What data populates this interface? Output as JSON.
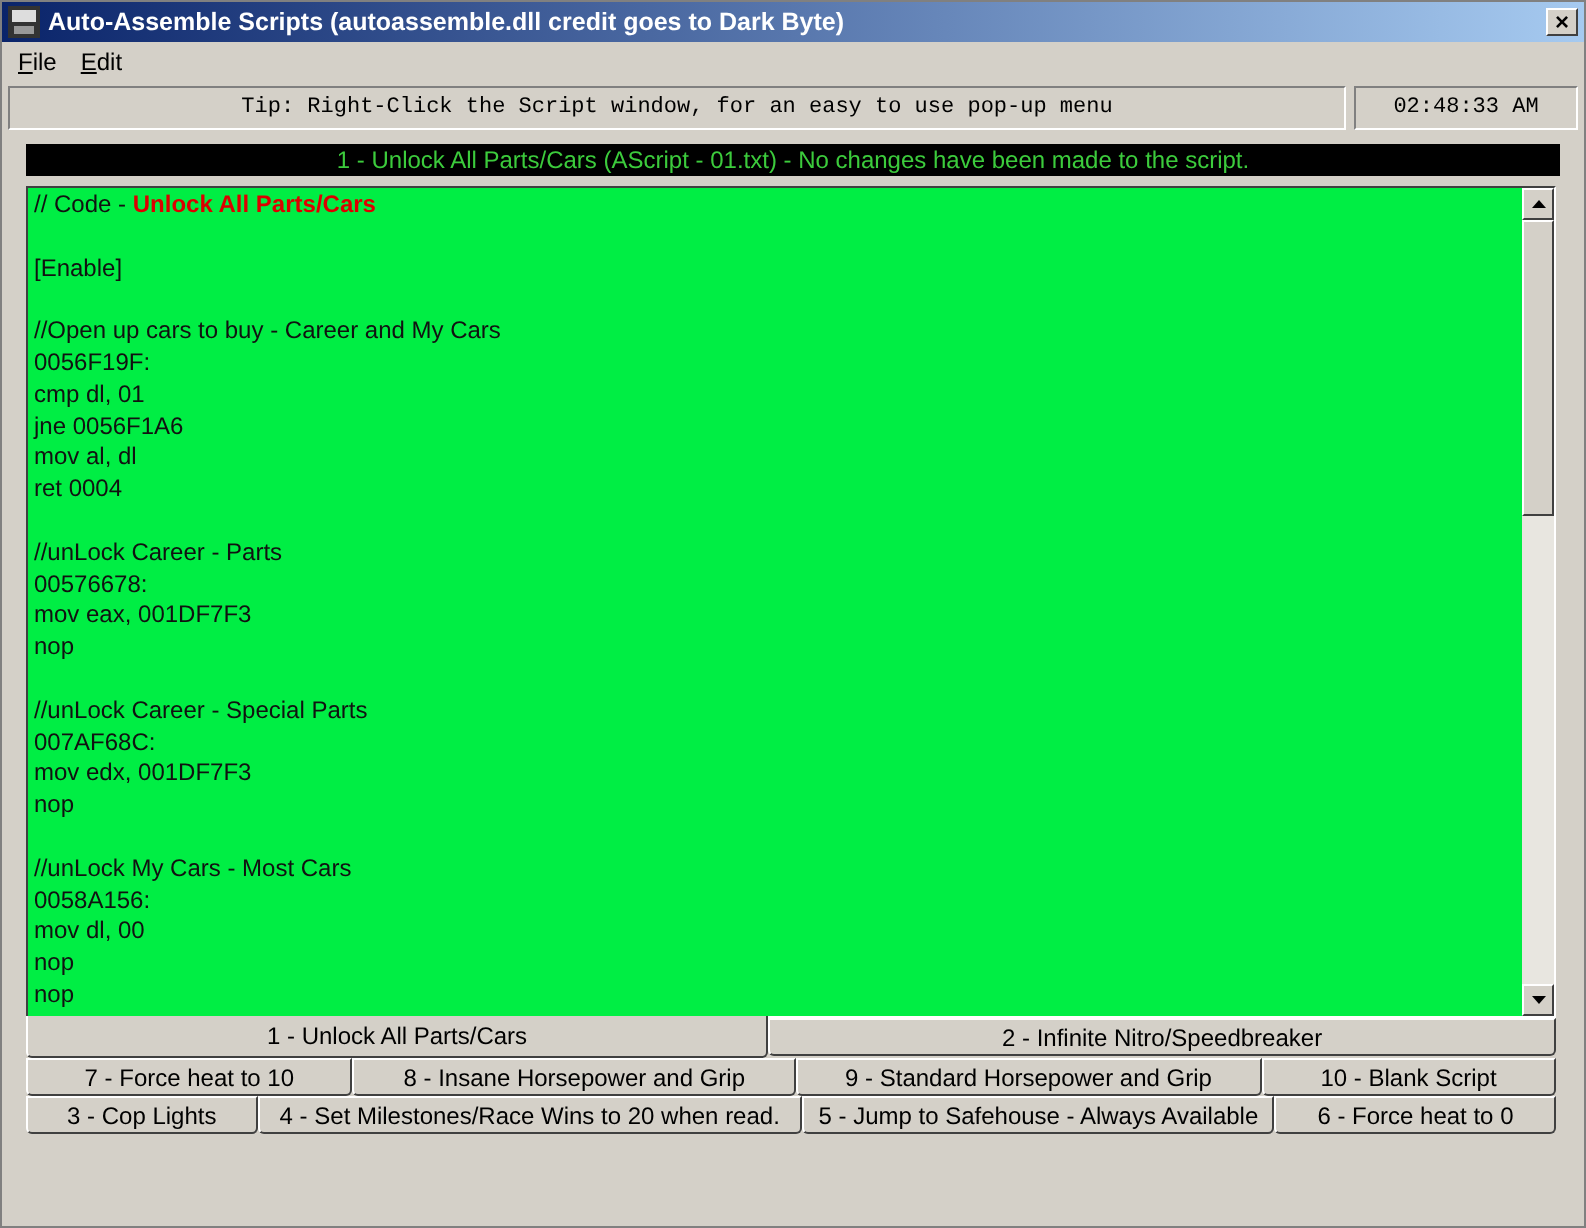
{
  "window": {
    "title": "Auto-Assemble Scripts (autoassemble.dll credit goes to Dark Byte)",
    "close": "×"
  },
  "menu": [
    {
      "label": "File"
    },
    {
      "label": "Edit"
    }
  ],
  "tip": "Tip: Right-Click the Script window, for an easy to use pop-up menu",
  "clock": "02:48:33 AM",
  "script_caption": "1 - Unlock All Parts/Cars (AScript - 01.txt)  - No changes have been made to the script.",
  "code_blocks": [
    [
      "// Code - **Unlock All Parts/Cars**"
    ],
    [
      "[Enable]"
    ],
    [
      "//Open up cars to buy - Career and My Cars",
      "0056F19F:",
      "cmp dl, 01",
      "jne 0056F1A6",
      "mov al, dl",
      "ret 0004"
    ],
    [
      "//unLock Career - Parts",
      "00576678:",
      "mov eax, 001DF7F3",
      "nop"
    ],
    [
      "//unLock Career - Special Parts",
      "007AF68C:",
      "mov edx, 001DF7F3",
      "nop"
    ],
    [
      "//unLock My Cars - Most Cars",
      "0058A156:",
      "mov dl, 00",
      "nop",
      "nop"
    ]
  ],
  "tab_rows": [
    [
      {
        "label": "1 - Unlock All Parts/Cars",
        "selected": true
      },
      {
        "label": "2 - Infinite Nitro/Speedbreaker",
        "selected": false
      }
    ],
    [
      {
        "label": "7 - Force heat to 10",
        "selected": false
      },
      {
        "label": "8 - Insane Horsepower and Grip",
        "selected": false
      },
      {
        "label": "9 - Standard Horsepower and Grip",
        "selected": false
      },
      {
        "label": "10 - Blank Script",
        "selected": false
      }
    ],
    [
      {
        "label": "3 - Cop Lights",
        "selected": false
      },
      {
        "label": "4 - Set Milestones/Race Wins to 20 when read.",
        "selected": false
      },
      {
        "label": "5 - Jump to Safehouse - Always Available",
        "selected": false
      },
      {
        "label": "6 - Force heat to 0",
        "selected": false
      }
    ]
  ]
}
